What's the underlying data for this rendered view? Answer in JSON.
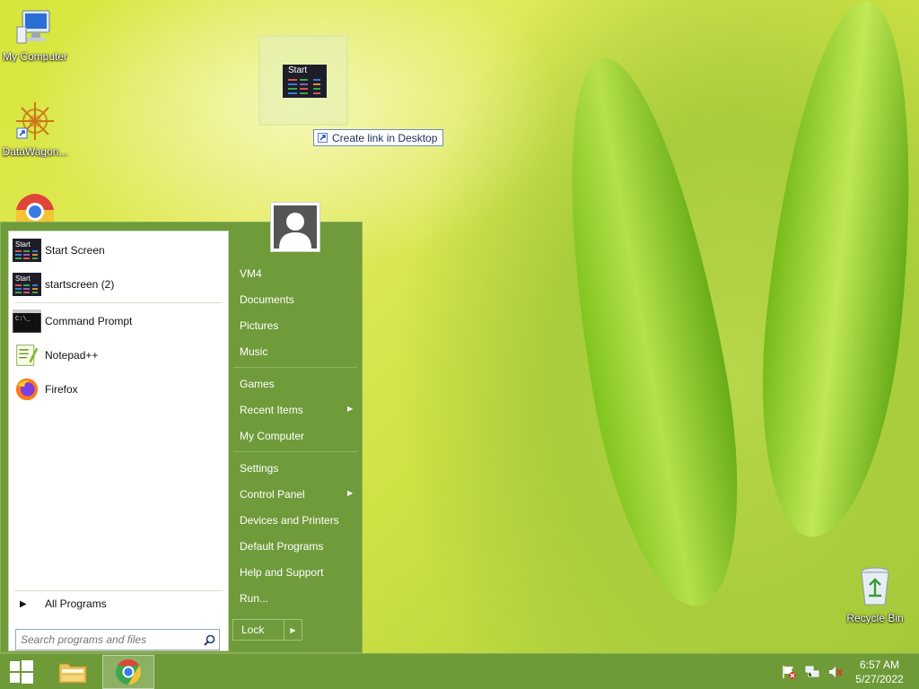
{
  "desktop": {
    "icons": [
      {
        "label": "My Computer"
      },
      {
        "label": "DataWagon..."
      },
      {
        "label": ""
      },
      {
        "label": "Recycle Bin"
      }
    ]
  },
  "drag": {
    "tile_label": "Start",
    "tooltip": "Create link in Desktop"
  },
  "start_menu": {
    "pinned": [
      {
        "label": "Start Screen",
        "icon": "start-screen-icon"
      },
      {
        "label": "startscreen (2)",
        "icon": "start-screen-icon"
      }
    ],
    "recent": [
      {
        "label": "Command Prompt",
        "icon": "cmd-icon"
      },
      {
        "label": "Notepad++",
        "icon": "notepadpp-icon"
      },
      {
        "label": "Firefox",
        "icon": "firefox-icon"
      }
    ],
    "all_programs": "All Programs",
    "search_placeholder": "Search programs and files",
    "tile_text": "Start",
    "right": {
      "user": "VM4",
      "documents": "Documents",
      "pictures": "Pictures",
      "music": "Music",
      "games": "Games",
      "recent_items": "Recent Items",
      "my_computer": "My Computer",
      "settings": "Settings",
      "control_panel": "Control Panel",
      "devices_printers": "Devices and Printers",
      "default_programs": "Default Programs",
      "help_support": "Help and Support",
      "run": "Run..."
    },
    "lock": "Lock"
  },
  "taskbar": {
    "time": "6:57 AM",
    "date": "5/27/2022"
  },
  "colors": {
    "menu_green": "#6f9b3a",
    "taskbar_green": "#6e9a38"
  }
}
